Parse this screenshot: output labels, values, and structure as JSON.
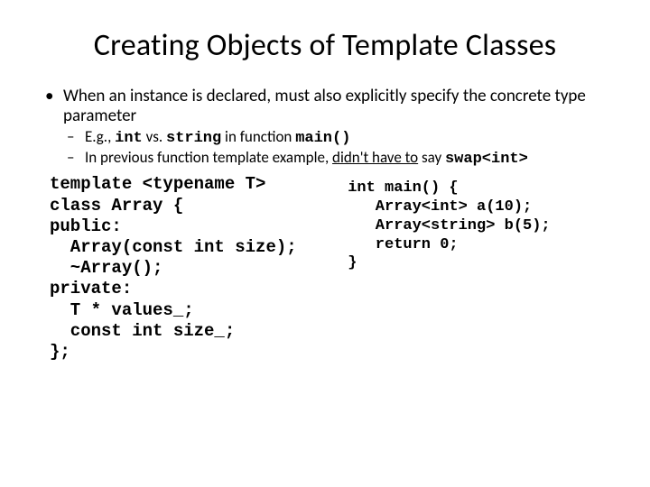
{
  "title": "Creating Objects of Template Classes",
  "bullet1": {
    "text_a": "When an instance is declared, must also explicitly specify the concrete type parameter",
    "sub1": {
      "prefix": "E.g., ",
      "code1": "int",
      "mid": " vs. ",
      "code2": "string",
      "mid2": " in function ",
      "code3": "main()"
    },
    "sub2": {
      "prefix": "In previous function template example, ",
      "underlined": "didn't have to",
      "mid": " say ",
      "code": "swap<int>"
    }
  },
  "code_left": "template <typename T>\nclass Array {\npublic:\n  Array(const int size);\n  ~Array();\nprivate:\n  T * values_;\n  const int size_;\n};",
  "code_right": "int main() {\n   Array<int> a(10);\n   Array<string> b(5);\n   return 0;\n}"
}
